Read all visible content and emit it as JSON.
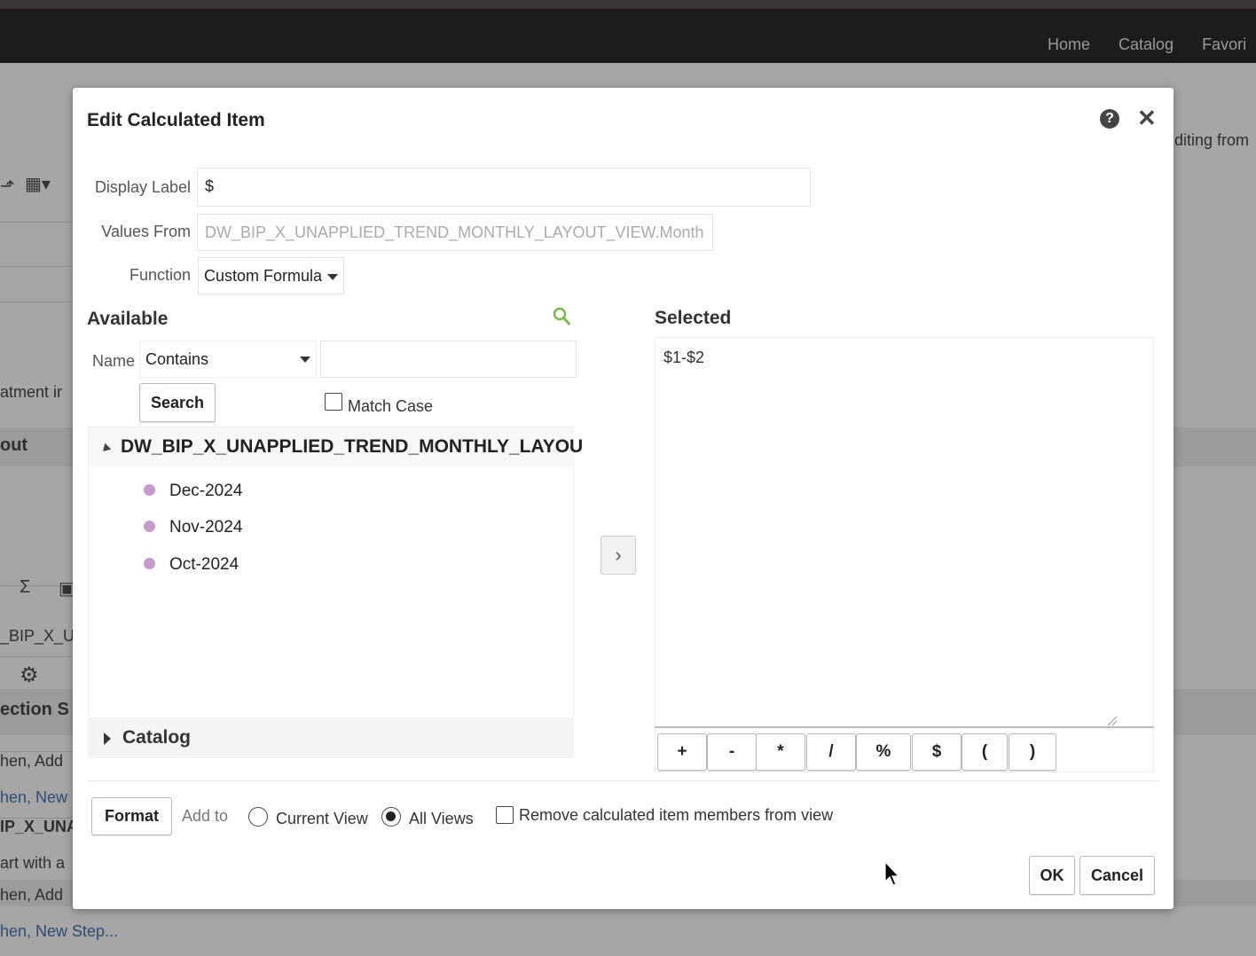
{
  "app": {
    "nav": [
      "Home",
      "Catalog",
      "Favori"
    ],
    "background_texts": {
      "editing": "diting from",
      "treatment": "atment ir",
      "layout": "out",
      "bip": "_BIP_X_U",
      "section": "ection S",
      "then_add_1": "hen, Add",
      "then_new_1": "hen, New",
      "bip2": "IP_X_UNA",
      "start_with": "art with a",
      "then_add_2": "hen, Add",
      "then_new_2": "hen, New Step..."
    }
  },
  "dialog": {
    "title": "Edit Calculated Item",
    "display_label": {
      "label": "Display Label",
      "value": "$"
    },
    "values_from": {
      "label": "Values From",
      "value": "DW_BIP_X_UNAPPLIED_TREND_MONTHLY_LAYOUT_VIEW.Month"
    },
    "function": {
      "label": "Function",
      "value": "Custom Formula"
    },
    "available": {
      "heading": "Available",
      "name_label": "Name",
      "name_operator": "Contains",
      "name_value": "",
      "search_label": "Search",
      "match_case_label": "Match Case",
      "match_case_checked": false,
      "tree_root": "DW_BIP_X_UNAPPLIED_TREND_MONTHLY_LAYOUT",
      "members": [
        "Dec-2024",
        "Nov-2024",
        "Oct-2024"
      ],
      "catalog_label": "Catalog"
    },
    "selected": {
      "heading": "Selected",
      "formula": "$1-$2",
      "operators": [
        "+",
        "-",
        "*",
        "/",
        "%",
        "$",
        "(",
        ")"
      ]
    },
    "footer": {
      "format_label": "Format",
      "add_to_label": "Add to",
      "current_view_label": "Current View",
      "all_views_label": "All Views",
      "add_to_selected": "All Views",
      "remove_members_label": "Remove calculated item members from view",
      "remove_members_checked": false,
      "ok_label": "OK",
      "cancel_label": "Cancel"
    }
  }
}
